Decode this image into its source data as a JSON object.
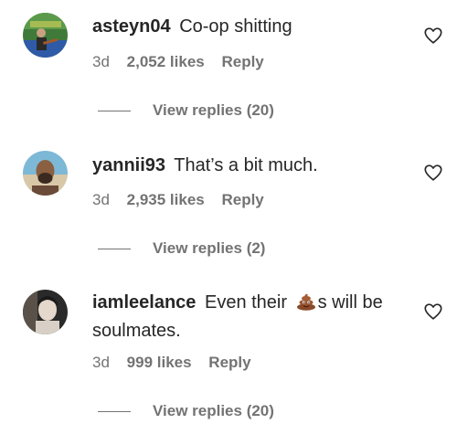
{
  "comments": [
    {
      "username": "asteyn04",
      "text": "Co-op shitting",
      "time": "3d",
      "likes": "2,052 likes",
      "reply_label": "Reply",
      "view_replies": "View replies (20)",
      "avatar_icon": "avatar-guitarist"
    },
    {
      "username": "yannii93",
      "text": "That’s a bit much.",
      "time": "3d",
      "likes": "2,935 likes",
      "reply_label": "Reply",
      "view_replies": "View replies (2)",
      "avatar_icon": "avatar-man-beach"
    },
    {
      "username": "iamleelance",
      "text_before_emoji": "Even their",
      "emoji": "poop-emoji",
      "text_after_emoji": "s will be soulmates.",
      "time": "3d",
      "likes": "999 likes",
      "reply_label": "Reply",
      "view_replies": "View replies (20)",
      "avatar_icon": "avatar-person-portrait"
    }
  ],
  "colors": {
    "primary_text": "#262626",
    "secondary_text": "#737373",
    "background": "#ffffff"
  }
}
